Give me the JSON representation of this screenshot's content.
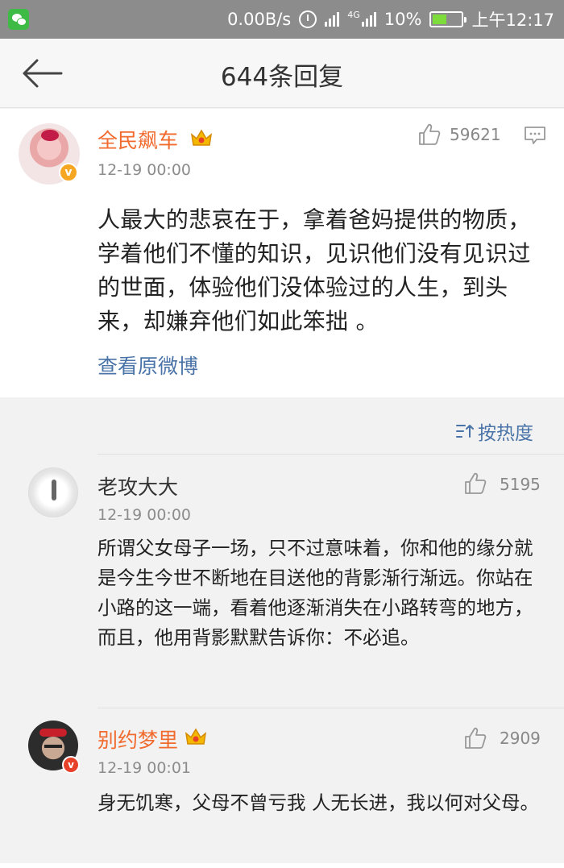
{
  "status_bar": {
    "speed": "0.00B/s",
    "battery": "10%",
    "battery_level": 0.1,
    "time": "上午12:17",
    "network": "4G"
  },
  "nav": {
    "title": "644条回复"
  },
  "post": {
    "username": "全民飙车",
    "time": "12-19 00:00",
    "likes": "59621",
    "text": "人最大的悲哀在于，拿着爸妈提供的物质，学着他们不懂的知识，见识他们没有见识过的世面，体验他们没体验过的人生，到头来，却嫌弃他们如此笨拙 。",
    "view_original": "查看原微博"
  },
  "sort": {
    "label": "按热度"
  },
  "comments": [
    {
      "username": "老攻大大",
      "time": "12-19 00:00",
      "likes": "5195",
      "text": "所谓父女母子一场，只不过意味着，你和他的缘分就是今生今世不断地在目送他的背影渐行渐远。你站在小路的这一端，看着他逐渐消失在小路转弯的地方，而且，他用背影默默告诉你：不必追。"
    },
    {
      "username": "别约梦里",
      "time": "12-19 00:01",
      "likes": "2909",
      "text": "身无饥寒，父母不曾亏我 人无长进，我以何对父母。"
    }
  ],
  "colors": {
    "vip_name": "#f16a2e",
    "link": "#4a74a8",
    "verified_badge": "#f5a623"
  },
  "icons": [
    "wechat-icon",
    "alarm-icon",
    "signal-icon",
    "battery-icon",
    "back-arrow-icon",
    "crown-icon",
    "verified-icon",
    "thumbs-up-icon",
    "comment-icon",
    "sort-icon"
  ]
}
